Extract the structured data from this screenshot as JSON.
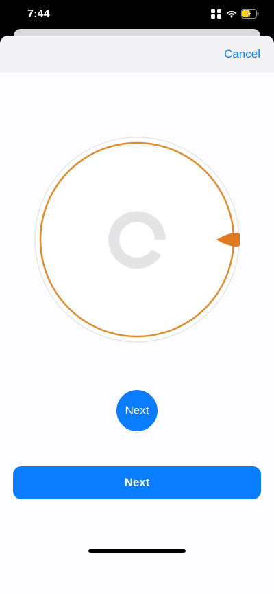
{
  "status_bar": {
    "time": "7:44",
    "icons": [
      "cellular-icon",
      "wifi-icon",
      "battery-charging-icon"
    ]
  },
  "header": {
    "cancel_label": "Cancel"
  },
  "dial": {
    "ring_color": "#e08a2e",
    "track_color": "#e6e6ea",
    "center_icon": "loading-spinner-icon",
    "pointer_icon": "orange-pointer-icon",
    "pointer_color": "#e07a1f"
  },
  "buttons": {
    "next_circle_label": "Next",
    "next_wide_label": "Next",
    "accent_color": "#0a7cff"
  }
}
